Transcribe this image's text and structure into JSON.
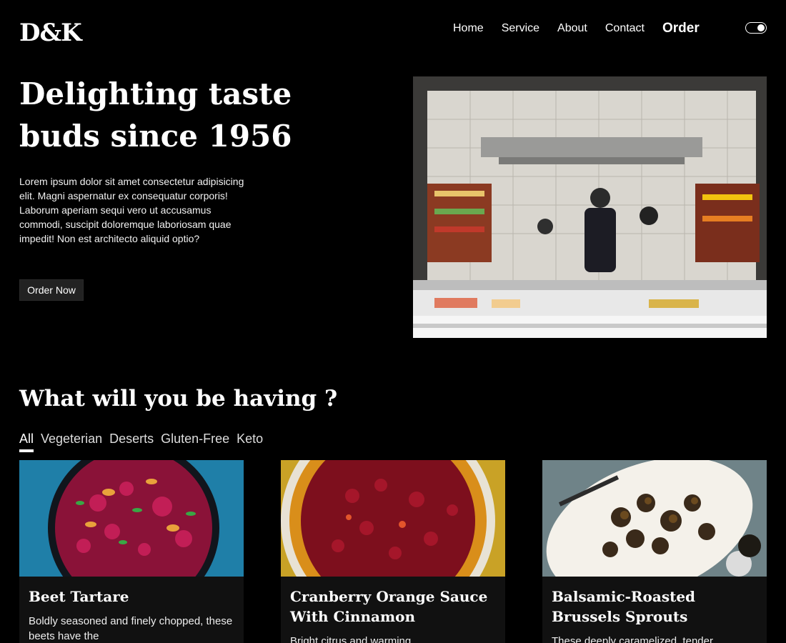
{
  "header": {
    "logo": "D&K",
    "nav": [
      {
        "label": "Home"
      },
      {
        "label": "Service"
      },
      {
        "label": "About"
      },
      {
        "label": "Contact"
      }
    ],
    "order_label": "Order"
  },
  "hero": {
    "title": "Delighting taste buds since 1956",
    "text": "Lorem ipsum dolor sit amet consectetur adipisicing elit. Magni aspernatur ex consequatur corporis! Laborum aperiam sequi vero ut accusamus commodi, suscipit doloremque laboriosam quae impedit! Non est architecto aliquid optio?",
    "cta": "Order Now"
  },
  "menu": {
    "title": "What will you be having ?",
    "filters": [
      {
        "label": "All",
        "active": true
      },
      {
        "label": "Vegeterian"
      },
      {
        "label": "Deserts"
      },
      {
        "label": "Gluten-Free"
      },
      {
        "label": "Keto"
      }
    ],
    "cards": [
      {
        "name": "Beet Tartare",
        "desc": "Boldly seasoned and finely chopped, these beets have the"
      },
      {
        "name": "Cranberry Orange Sauce With Cinnamon",
        "desc": "Bright citrus and warming"
      },
      {
        "name": "Balsamic-Roasted Brussels Sprouts",
        "desc": "These deeply caramelized, tender"
      }
    ]
  },
  "colors": {
    "background": "#000000",
    "text": "#ffffff",
    "button_bg": "#222222"
  }
}
